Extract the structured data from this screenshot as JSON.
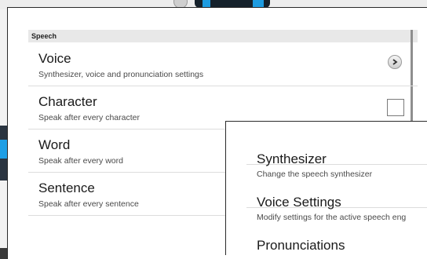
{
  "section_header": "Speech",
  "items": [
    {
      "title": "Voice",
      "subtitle": "Synthesizer, voice and pronunciation settings",
      "control": "chevron-right-icon"
    },
    {
      "title": "Character",
      "subtitle": "Speak after every character",
      "control": "checkbox"
    },
    {
      "title": "Word",
      "subtitle": "Speak after every word"
    },
    {
      "title": "Sentence",
      "subtitle": "Speak after every sentence"
    }
  ],
  "overlay_items": [
    {
      "title": "Synthesizer",
      "subtitle": "Change the speech synthesizer"
    },
    {
      "title": "Voice Settings",
      "subtitle": "Modify settings for the active speech eng"
    },
    {
      "title": "Pronunciations",
      "subtitle": ""
    }
  ],
  "colors": {
    "section_header_bg": "#e8e8e8",
    "accent_blue": "#1d9be0"
  }
}
